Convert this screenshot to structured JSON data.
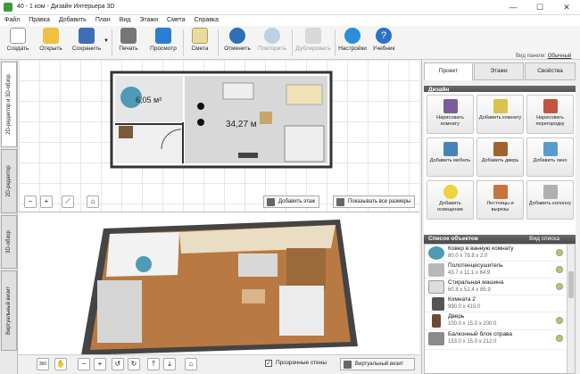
{
  "window": {
    "title": "40 - 1 ком - Дизайн Интерьера 3D",
    "minimize": "—",
    "maximize": "☐",
    "close": "✕"
  },
  "menu": [
    "Файл",
    "Правка",
    "Добавить",
    "План",
    "Вид",
    "Этажи",
    "Смета",
    "Справка"
  ],
  "toolbar": {
    "create": "Создать",
    "open": "Открыть",
    "save": "Сохранить",
    "print": "Печать",
    "preview": "Просмотр",
    "estimate": "Смета",
    "undo": "Отменить",
    "redo": "Повторить",
    "duplicate": "Дублировать",
    "settings": "Настройки",
    "tutorial": "Учебник"
  },
  "panel_view": {
    "label": "Вид панели:",
    "value": "Обычный"
  },
  "left_tabs": [
    "2D-редактор и 3D-обзор",
    "2D-редактор",
    "3D-обзор",
    "Виртуальный визит"
  ],
  "plan": {
    "room1_area": "6,05 м²",
    "room2_area": "34,27 м"
  },
  "plan_bar": {
    "add_floor": "Добавить этаж",
    "show_sizes": "Показывать все размеры"
  },
  "view3d_bar": {
    "transparent_walls": "Прозрачные стены",
    "virtual_visit": "Виртуальный визит",
    "rotate360": "360"
  },
  "right_tabs": [
    "Проект",
    "Этажи",
    "Свойства"
  ],
  "design": {
    "header": "Дизайн",
    "buttons": [
      "Нарисовать комнату",
      "Добавить комнату",
      "Нарисовать перегородку",
      "Добавить мебель",
      "Добавить дверь",
      "Добавить окно",
      "Добавить освещение",
      "Лестницы и вырезы",
      "Добавить колонну"
    ]
  },
  "objects": {
    "header": "Список объектов",
    "view_list": "Вид списка",
    "items": [
      {
        "name": "Ковер в ванную комнату",
        "size": "80.0 x 79.8 x 2.0",
        "color": "#4f9ab6"
      },
      {
        "name": "Полотенцесушитель",
        "size": "43.7 x 11.1 x 64.9",
        "color": "#b8b8b8"
      },
      {
        "name": "Стиральная машина",
        "size": "60.8 x 52.4 x 85.9",
        "color": "#dddddd"
      },
      {
        "name": "Комната 2",
        "size": "990.0 x 415.0",
        "color": "#555555"
      },
      {
        "name": "Дверь",
        "size": "100.0 x 15.0 x 200.0",
        "color": "#6b4a32"
      },
      {
        "name": "Балконный блок справа",
        "size": "153.0 x 15.0 x 212.0",
        "color": "#8a8a8a"
      }
    ]
  }
}
